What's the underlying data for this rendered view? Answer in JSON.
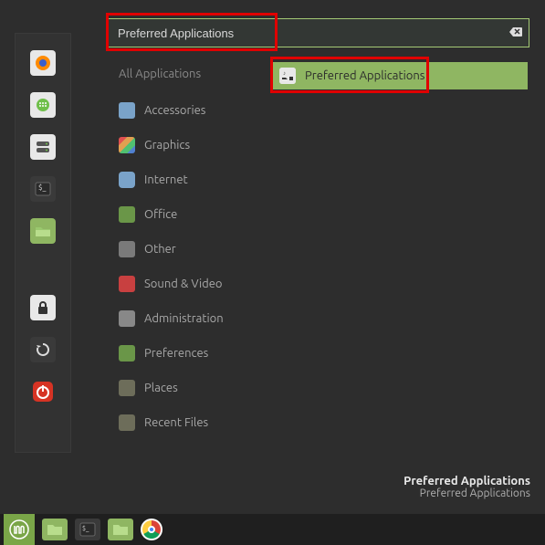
{
  "search": {
    "value": "Preferred Applications"
  },
  "categories_header": "All Applications",
  "categories": [
    {
      "label": "Accessories",
      "icon": "ci-accessories"
    },
    {
      "label": "Graphics",
      "icon": "ci-graphics"
    },
    {
      "label": "Internet",
      "icon": "ci-internet"
    },
    {
      "label": "Office",
      "icon": "ci-office"
    },
    {
      "label": "Other",
      "icon": "ci-other"
    },
    {
      "label": "Sound & Video",
      "icon": "ci-sound"
    },
    {
      "label": "Administration",
      "icon": "ci-admin"
    },
    {
      "label": "Preferences",
      "icon": "ci-prefs"
    },
    {
      "label": "Places",
      "icon": "ci-places"
    },
    {
      "label": "Recent Files",
      "icon": "ci-recent"
    }
  ],
  "result": {
    "label": "Preferred Applications"
  },
  "info": {
    "title": "Preferred Applications",
    "subtitle": "Preferred Applications"
  },
  "dock": [
    {
      "name": "firefox-icon",
      "bg": "di-white",
      "inner": "ff"
    },
    {
      "name": "circle-app-icon",
      "bg": "di-white",
      "inner": "green-dot"
    },
    {
      "name": "servers-icon",
      "bg": "di-white",
      "inner": "servers"
    },
    {
      "name": "terminal-icon",
      "bg": "di-dark",
      "inner": "terminal"
    },
    {
      "name": "files-icon",
      "bg": "di-green",
      "inner": "folder"
    },
    {
      "name": "lock-icon",
      "bg": "di-white",
      "inner": "lock"
    },
    {
      "name": "restart-icon",
      "bg": "di-dark",
      "inner": "restart"
    },
    {
      "name": "power-icon",
      "bg": "",
      "inner": "power"
    }
  ],
  "taskbar": [
    {
      "name": "mint-menu-icon"
    },
    {
      "name": "files-task-icon"
    },
    {
      "name": "terminal-task-icon"
    },
    {
      "name": "files-task-icon-2"
    },
    {
      "name": "chrome-task-icon"
    }
  ]
}
